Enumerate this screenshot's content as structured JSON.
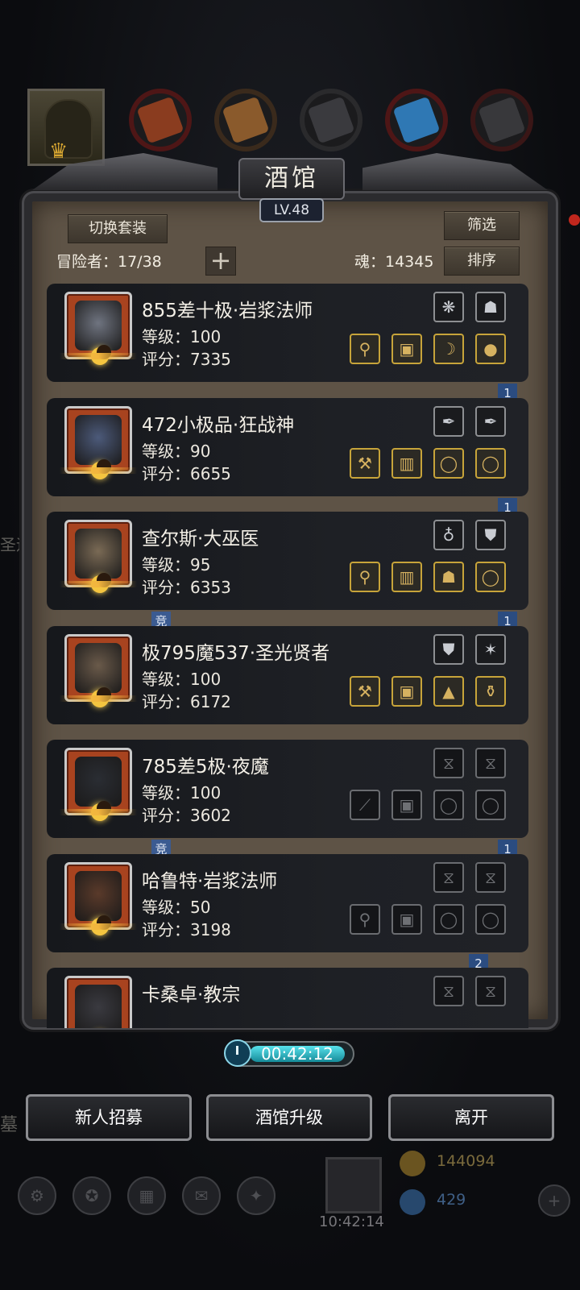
{
  "header": {
    "title": "酒馆",
    "level": "LV.48"
  },
  "top_tabs": [
    "hero-avatar",
    "cloak-resource",
    "leather-resource",
    "iron-resource",
    "crystal-resource",
    "stone-resource"
  ],
  "dim_texts": {
    "left_partial": "圣运",
    "left_partial2": "墓"
  },
  "controls": {
    "switch_set": "切换套装",
    "filter": "筛选",
    "sort": "排序",
    "adventurers_label": "冒险者：17/38",
    "add_symbol": "+",
    "souls_label": "魂：14345"
  },
  "heroes": [
    {
      "name": "855差十极·岩浆法师",
      "level": "等级：100",
      "score": "评分：7335",
      "top_slots": [
        {
          "type": "accessory",
          "icon": "wing-icon"
        },
        {
          "type": "accessory",
          "icon": "mask-icon"
        }
      ],
      "bottom_slots": [
        {
          "type": "equip",
          "icon": "staff-icon"
        },
        {
          "type": "equip",
          "icon": "armor-icon"
        },
        {
          "type": "equip",
          "icon": "bow-icon"
        },
        {
          "type": "equip",
          "icon": "orb-icon"
        }
      ],
      "badge_right": "1",
      "badge_left": ""
    },
    {
      "name": "472小极品·狂战神",
      "level": "等级：90",
      "score": "评分：6655",
      "top_slots": [
        {
          "type": "accessory",
          "icon": "feather-icon"
        },
        {
          "type": "accessory",
          "icon": "feather-icon"
        }
      ],
      "bottom_slots": [
        {
          "type": "equip",
          "icon": "axe-icon"
        },
        {
          "type": "equip",
          "icon": "robe-icon"
        },
        {
          "type": "equip",
          "icon": "ring-icon"
        },
        {
          "type": "equip",
          "icon": "ring-icon"
        }
      ],
      "badge_right": "1",
      "badge_left": ""
    },
    {
      "name": "查尔斯·大巫医",
      "level": "等级：95",
      "score": "评分：6353",
      "top_slots": [
        {
          "type": "accessory",
          "icon": "amulet-icon"
        },
        {
          "type": "accessory",
          "icon": "shield-icon"
        }
      ],
      "bottom_slots": [
        {
          "type": "equip",
          "icon": "staff-icon"
        },
        {
          "type": "equip",
          "icon": "robe-icon"
        },
        {
          "type": "equip",
          "icon": "helmet-icon"
        },
        {
          "type": "equip",
          "icon": "ring-icon"
        }
      ],
      "badge_right": "1",
      "badge_left": "竞"
    },
    {
      "name": "极795魔537·圣光贤者",
      "level": "等级：100",
      "score": "评分：6172",
      "top_slots": [
        {
          "type": "accessory",
          "icon": "shield-icon"
        },
        {
          "type": "accessory",
          "icon": "star-icon"
        }
      ],
      "bottom_slots": [
        {
          "type": "equip",
          "icon": "hammer-icon"
        },
        {
          "type": "equip",
          "icon": "armor-icon"
        },
        {
          "type": "equip",
          "icon": "cloak-icon"
        },
        {
          "type": "equip",
          "icon": "potion-icon"
        }
      ],
      "badge_right": "",
      "badge_left": ""
    },
    {
      "name": "785差5极·夜魔",
      "level": "等级：100",
      "score": "评分：3602",
      "top_slots": [
        {
          "type": "empty",
          "icon": "hourglass-icon"
        },
        {
          "type": "empty",
          "icon": "hourglass-icon"
        }
      ],
      "bottom_slots": [
        {
          "type": "empty",
          "icon": "blade-icon"
        },
        {
          "type": "empty",
          "icon": "armor-icon"
        },
        {
          "type": "empty",
          "icon": "ring-icon"
        },
        {
          "type": "empty",
          "icon": "ring-icon"
        }
      ],
      "badge_right": "1",
      "badge_left": "竞"
    },
    {
      "name": "哈鲁特·岩浆法师",
      "level": "等级：50",
      "score": "评分：3198",
      "top_slots": [
        {
          "type": "empty",
          "icon": "hourglass-icon"
        },
        {
          "type": "empty",
          "icon": "hourglass-icon"
        }
      ],
      "bottom_slots": [
        {
          "type": "empty",
          "icon": "staff-icon"
        },
        {
          "type": "empty",
          "icon": "armor-icon"
        },
        {
          "type": "empty",
          "icon": "ring-icon"
        },
        {
          "type": "empty",
          "icon": "ring-icon"
        }
      ],
      "badge_right": "2",
      "badge_left": ""
    },
    {
      "name": "卡桑卓·教宗",
      "level": "",
      "score": "",
      "top_slots": [
        {
          "type": "empty",
          "icon": "hourglass-icon"
        },
        {
          "type": "empty",
          "icon": "hourglass-icon"
        }
      ],
      "bottom_slots": [],
      "badge_right": "",
      "badge_left": ""
    }
  ],
  "timer": {
    "time": "00:42:12"
  },
  "bottom_buttons": {
    "recruit": "新人招募",
    "upgrade": "酒馆升级",
    "leave": "离开"
  },
  "background_hud": {
    "gold": "144094",
    "gems": "429",
    "gift_timer": "10:42:14"
  },
  "colors": {
    "panel": "#5e5346",
    "card": "#1c1e23",
    "equip_border": "#c7a43a",
    "ribbon": "#2b4c80",
    "timer_fill": "#3fd0dc"
  }
}
